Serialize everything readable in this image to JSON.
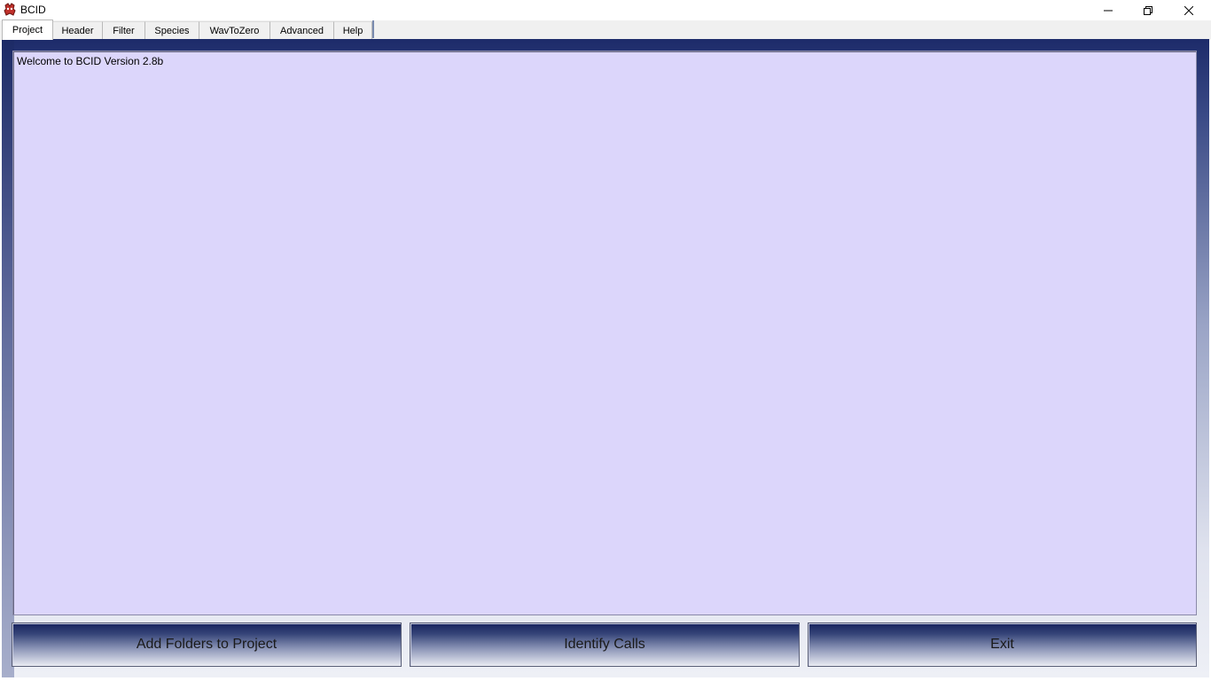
{
  "window": {
    "title": "BCID",
    "icon": "bcid-app-icon",
    "controls": [
      "minimize-icon",
      "restore-icon",
      "close-icon"
    ]
  },
  "tabs": [
    {
      "label": "Project",
      "active": true
    },
    {
      "label": "Header",
      "active": false
    },
    {
      "label": "Filter",
      "active": false
    },
    {
      "label": "Species",
      "active": false
    },
    {
      "label": "WavToZero",
      "active": false
    },
    {
      "label": "Advanced",
      "active": false
    },
    {
      "label": "Help",
      "active": false
    }
  ],
  "log": {
    "text": "Welcome to BCID Version 2.8b",
    "background": "#dcd6fb"
  },
  "buttons": {
    "add_folders": "Add Folders to Project",
    "identify_calls": "Identify Calls",
    "exit": "Exit"
  },
  "colors": {
    "gradient_dark": "#1d2b6a",
    "gradient_light": "#eef0f6"
  }
}
